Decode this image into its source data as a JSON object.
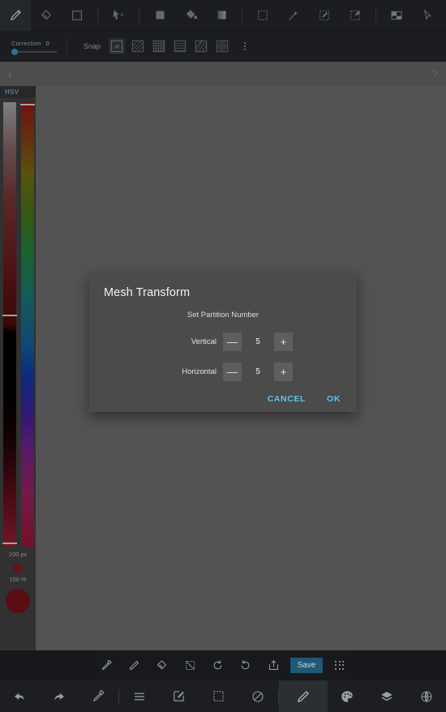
{
  "toolbar_top": {
    "tools": [
      {
        "name": "pencil-tool",
        "icon": "pencil",
        "active": true
      },
      {
        "name": "eraser-tool",
        "icon": "eraser",
        "active": false
      },
      {
        "name": "shape-rectangle-tool",
        "icon": "square-outline",
        "active": false
      },
      {
        "sep": true
      },
      {
        "name": "move-transform-tool",
        "icon": "cursor-move",
        "active": false
      },
      {
        "sep": true
      },
      {
        "name": "fill-solid-tool",
        "icon": "square-filled",
        "active": false
      },
      {
        "name": "paint-bucket-tool",
        "icon": "paint-bucket",
        "active": false
      },
      {
        "name": "gradient-tool",
        "icon": "gradient-square",
        "active": false
      },
      {
        "sep": true
      },
      {
        "name": "marquee-select-tool",
        "icon": "dashed-square",
        "active": false
      },
      {
        "name": "magic-wand-tool",
        "icon": "magic-wand",
        "active": false
      },
      {
        "name": "selection-edit-tool",
        "icon": "dashed-square-pencil",
        "active": false
      },
      {
        "name": "selection-add-tool",
        "icon": "dashed-square-stamp",
        "active": false
      },
      {
        "sep": true
      },
      {
        "name": "perspective-tool",
        "icon": "perspective",
        "active": false
      },
      {
        "name": "pointer-tool",
        "icon": "arrow-pointer",
        "active": false
      },
      {
        "name": "text-tool",
        "icon": "text-aa",
        "active": false
      }
    ]
  },
  "toolbar_sub": {
    "correction_label": "Correction",
    "correction_value": "0",
    "snap_label": "Snap",
    "snap_options": [
      {
        "name": "snap-off",
        "label": "off",
        "active": true
      },
      {
        "name": "snap-diagonal",
        "label": "",
        "active": false
      },
      {
        "name": "snap-grid",
        "label": "",
        "active": false
      },
      {
        "name": "snap-horizontal",
        "label": "",
        "active": false
      },
      {
        "name": "snap-perspective",
        "label": "",
        "active": false
      },
      {
        "name": "snap-radial",
        "label": "",
        "active": false
      }
    ],
    "more_label": "more-options"
  },
  "canvas": {
    "back_glyph": "‹",
    "help_glyph": "?"
  },
  "color_panel": {
    "tab_label": "HSV",
    "brush_size_label": "100 px",
    "opacity_label": "100 %",
    "current_color": "#6e1018"
  },
  "dialog": {
    "title": "Mesh Transform",
    "subtitle": "Set Partition Number",
    "rows": [
      {
        "label": "Vertical",
        "value": "5",
        "minus": "—",
        "plus": "+"
      },
      {
        "label": "Horizontal",
        "value": "5",
        "minus": "—",
        "plus": "+"
      }
    ],
    "cancel_label": "CANCEL",
    "ok_label": "OK",
    "accent_color": "#5ec2ea"
  },
  "quickbar": {
    "buttons": [
      {
        "name": "eyedropper-button",
        "icon": "eyedropper"
      },
      {
        "name": "pencil-button",
        "icon": "pencil"
      },
      {
        "name": "eraser-button",
        "icon": "eraser"
      },
      {
        "name": "deselect-button",
        "icon": "dashed-square-slash"
      },
      {
        "name": "undo-button",
        "icon": "undo-circular"
      },
      {
        "name": "redo-button",
        "icon": "redo-circular"
      },
      {
        "name": "share-button",
        "icon": "share-export"
      }
    ],
    "save_label": "Save",
    "save_color": "#1f5878",
    "handle_name": "drag-handle-dots"
  },
  "bottomnav": {
    "items": [
      {
        "name": "undo-nav",
        "icon": "undo-arrow",
        "active": false
      },
      {
        "name": "redo-nav",
        "icon": "redo-arrow",
        "active": false
      },
      {
        "name": "eyedropper-nav",
        "icon": "eyedropper",
        "active": false
      },
      {
        "sep": true
      },
      {
        "name": "menu-nav",
        "icon": "hamburger",
        "active": false
      },
      {
        "name": "edit-nav",
        "icon": "edit-square",
        "active": false
      },
      {
        "name": "select-nav",
        "icon": "dashed-square",
        "active": false
      },
      {
        "name": "transparency-nav",
        "icon": "circle-slash",
        "active": false
      },
      {
        "sep": true
      },
      {
        "name": "brush-nav",
        "icon": "pencil",
        "active": true
      },
      {
        "name": "palette-nav",
        "icon": "palette",
        "active": false
      },
      {
        "name": "layers-nav",
        "icon": "layers",
        "active": false
      },
      {
        "name": "settings-nav",
        "icon": "target-globe",
        "active": false
      }
    ]
  }
}
